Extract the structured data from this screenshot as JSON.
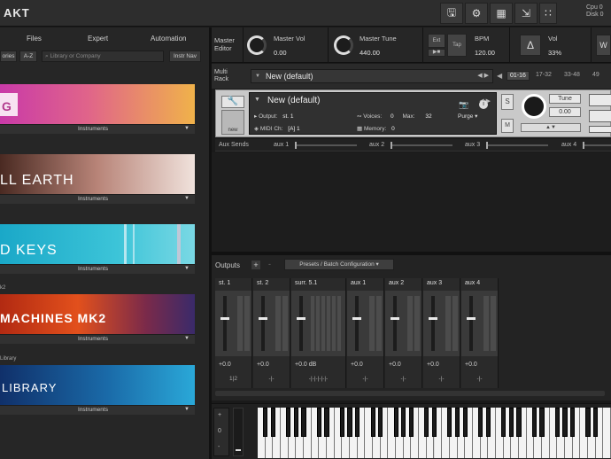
{
  "app": {
    "title": "AKT"
  },
  "top_icons": [
    "save-icon",
    "gear-icon",
    "layout-icon",
    "resize-icon"
  ],
  "cpu": {
    "cpu_label": "Cpu",
    "disk_label": "Disk",
    "value": "0"
  },
  "browser": {
    "tabs": [
      "Files",
      "Expert",
      "Automation"
    ],
    "filter": {
      "btn1": "ories",
      "btn2": "A-Z",
      "search_placeholder": "Library or Company",
      "btn3": "Instr Nav"
    },
    "libraries": [
      {
        "pre": "",
        "name": "G",
        "footer": "Instruments"
      },
      {
        "pre": "",
        "name": "LL EARTH",
        "footer": "Instruments"
      },
      {
        "pre": "",
        "name": "D KEYS",
        "footer": "Instruments"
      },
      {
        "pre": "k2",
        "name": "MACHINES MK2",
        "footer": "Instruments"
      },
      {
        "pre": "Library",
        "name": "LIBRARY",
        "footer": "Instruments"
      }
    ]
  },
  "master": {
    "editor_label": "Master\nEditor",
    "vol_label": "Master Vol",
    "vol_value": "0.00",
    "tune_label": "Master Tune",
    "tune_value": "440.00",
    "ext_label": "Ext",
    "tap_label": "Tap",
    "bpm_label": "BPM",
    "bpm_value": "120.00",
    "vol2_label": "Vol",
    "vol2_value": "33%"
  },
  "rack": {
    "label": "Multi\nRack",
    "title": "New (default)",
    "tabs": [
      "01-16",
      "17-32",
      "33-48",
      "49"
    ]
  },
  "instrument": {
    "name": "New (default)",
    "output_label": "Output:",
    "output_value": "st. 1",
    "voices_label": "Voices:",
    "voices_value": "0",
    "max_label": "Max:",
    "max_value": "32",
    "purge_label": "Purge",
    "midi_label": "MIDI Ch:",
    "midi_value": "[A] 1",
    "memory_label": "Memory:",
    "memory_value": "0",
    "tune_label": "Tune",
    "tune_value": "0.00",
    "new_label": "new",
    "solo_label": "S",
    "mute_label": "M"
  },
  "aux": {
    "label": "Aux Sends",
    "sends": [
      {
        "name": "aux 1",
        "level": 0
      },
      {
        "name": "aux 2",
        "level": 0
      },
      {
        "name": "aux 3",
        "level": 0
      },
      {
        "name": "aux 4",
        "level": 0
      }
    ]
  },
  "outputs": {
    "title": "Outputs",
    "plus": "+",
    "minus": "-",
    "presets": "Presets / Batch Configuration",
    "strips": [
      {
        "name": "st. 1",
        "value": "+0.0",
        "route": "1|2"
      },
      {
        "name": "st. 2",
        "value": "+0.0",
        "route": "-|-"
      },
      {
        "name": "surr. 5.1",
        "value": "+0.0 dB",
        "route": "-|-|-|-|-|-"
      },
      {
        "name": "aux 1",
        "value": "+0.0",
        "route": "-|-"
      },
      {
        "name": "aux 2",
        "value": "+0.0",
        "route": "-|-"
      },
      {
        "name": "aux 3",
        "value": "+0.0",
        "route": "-|-"
      },
      {
        "name": "aux 4",
        "value": "+0.0",
        "route": "-|-"
      }
    ]
  },
  "keyboard": {
    "plus": "+",
    "zero": "0",
    "minus": "-",
    "white_keys": 46
  }
}
